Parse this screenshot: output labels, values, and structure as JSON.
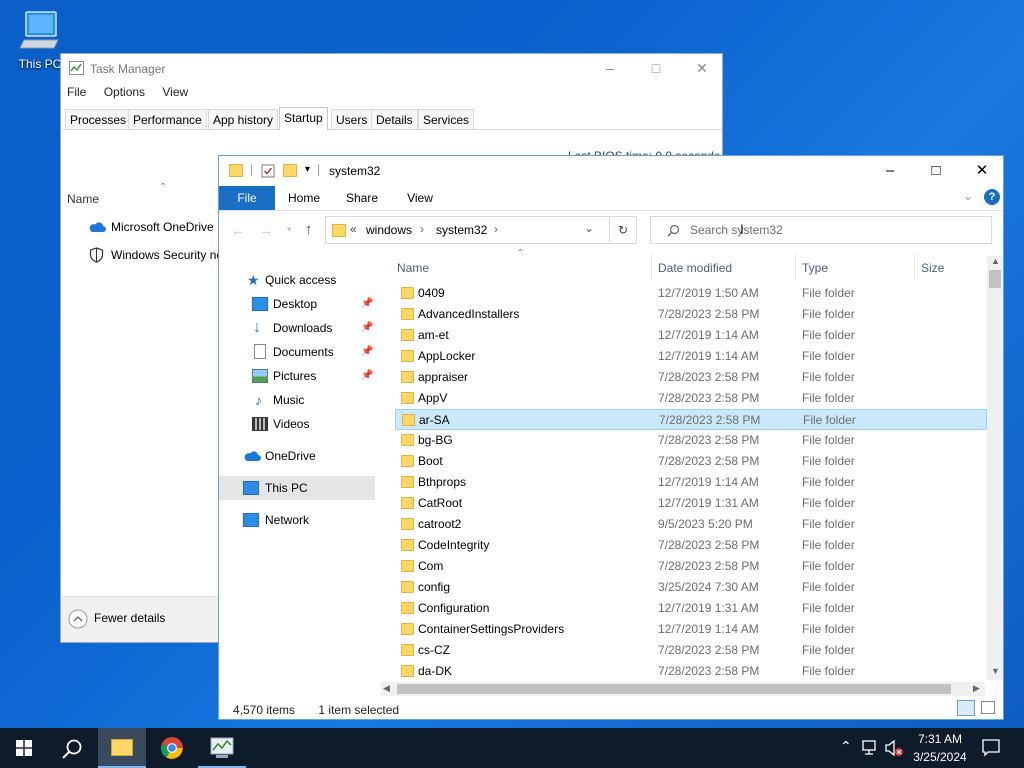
{
  "desktop": {
    "this_pc_label": "This PC"
  },
  "task_manager": {
    "title": "Task Manager",
    "menu": [
      "File",
      "Options",
      "View"
    ],
    "tabs": [
      "Processes",
      "Performance",
      "App history",
      "Startup",
      "Users",
      "Details",
      "Services"
    ],
    "active_tab": "Startup",
    "bios_time_label": "Last BIOS time:",
    "bios_time_value": "0.0 seconds",
    "column_name": "Name",
    "items": [
      "Microsoft OneDrive",
      "Windows Security no"
    ],
    "fewer_details": "Fewer details"
  },
  "explorer": {
    "title": "system32",
    "ribbon_tabs": [
      "File",
      "Home",
      "Share",
      "View"
    ],
    "breadcrumb": [
      "windows",
      "system32"
    ],
    "breadcrumb_prefix": "«",
    "search_placeholder": "Search system32",
    "nav": {
      "quick_access": "Quick access",
      "desktop": "Desktop",
      "downloads": "Downloads",
      "documents": "Documents",
      "pictures": "Pictures",
      "music": "Music",
      "videos": "Videos",
      "onedrive": "OneDrive",
      "this_pc": "This PC",
      "network": "Network"
    },
    "columns": {
      "name": "Name",
      "date": "Date modified",
      "type": "Type",
      "size": "Size"
    },
    "rows": [
      {
        "name": "0409",
        "date": "12/7/2019 1:50 AM",
        "type": "File folder"
      },
      {
        "name": "AdvancedInstallers",
        "date": "7/28/2023 2:58 PM",
        "type": "File folder"
      },
      {
        "name": "am-et",
        "date": "12/7/2019 1:14 AM",
        "type": "File folder"
      },
      {
        "name": "AppLocker",
        "date": "12/7/2019 1:14 AM",
        "type": "File folder"
      },
      {
        "name": "appraiser",
        "date": "7/28/2023 2:58 PM",
        "type": "File folder"
      },
      {
        "name": "AppV",
        "date": "7/28/2023 2:58 PM",
        "type": "File folder"
      },
      {
        "name": "ar-SA",
        "date": "7/28/2023 2:58 PM",
        "type": "File folder"
      },
      {
        "name": "bg-BG",
        "date": "7/28/2023 2:58 PM",
        "type": "File folder"
      },
      {
        "name": "Boot",
        "date": "7/28/2023 2:58 PM",
        "type": "File folder"
      },
      {
        "name": "Bthprops",
        "date": "12/7/2019 1:14 AM",
        "type": "File folder"
      },
      {
        "name": "CatRoot",
        "date": "12/7/2019 1:31 AM",
        "type": "File folder"
      },
      {
        "name": "catroot2",
        "date": "9/5/2023 5:20 PM",
        "type": "File folder"
      },
      {
        "name": "CodeIntegrity",
        "date": "7/28/2023 2:58 PM",
        "type": "File folder"
      },
      {
        "name": "Com",
        "date": "7/28/2023 2:58 PM",
        "type": "File folder"
      },
      {
        "name": "config",
        "date": "3/25/2024 7:30 AM",
        "type": "File folder"
      },
      {
        "name": "Configuration",
        "date": "12/7/2019 1:31 AM",
        "type": "File folder"
      },
      {
        "name": "ContainerSettingsProviders",
        "date": "12/7/2019 1:14 AM",
        "type": "File folder"
      },
      {
        "name": "cs-CZ",
        "date": "7/28/2023 2:58 PM",
        "type": "File folder"
      },
      {
        "name": "da-DK",
        "date": "7/28/2023 2:58 PM",
        "type": "File folder"
      }
    ],
    "selected_row": "ar-SA",
    "status_items": "4,570 items",
    "status_selected": "1 item selected"
  },
  "taskbar": {
    "time": "7:31 AM",
    "date": "3/25/2024"
  },
  "colors": {
    "accent": "#1a6fc4",
    "selection": "#cce8ff",
    "taskbar": "#0e1b2a"
  }
}
